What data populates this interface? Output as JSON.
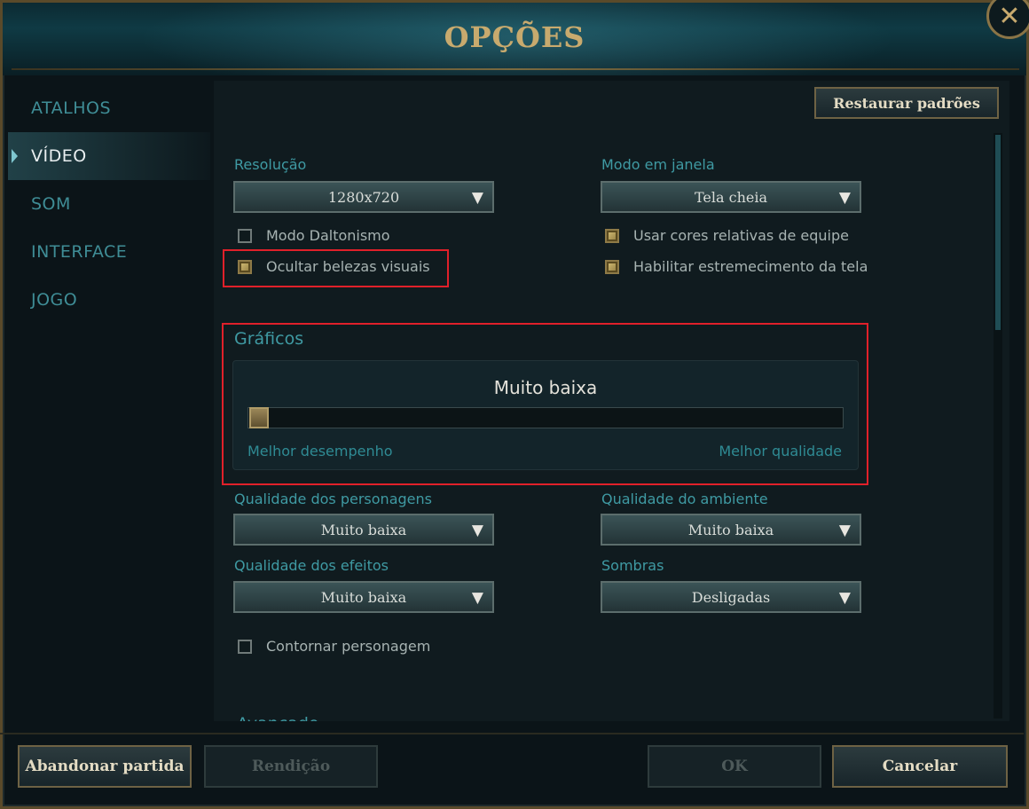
{
  "window": {
    "title": "OPÇÕES",
    "close_glyph": "✕"
  },
  "sidebar": {
    "items": [
      {
        "label": "ATALHOS"
      },
      {
        "label": "VÍDEO"
      },
      {
        "label": "SOM"
      },
      {
        "label": "INTERFACE"
      },
      {
        "label": "JOGO"
      }
    ]
  },
  "toolbar": {
    "restore_label": "Restaurar padrões"
  },
  "video": {
    "resolution_label": "Resolução",
    "resolution_value": "1280x720",
    "window_mode_label": "Modo em janela",
    "window_mode_value": "Tela cheia",
    "colorblind_label": "Modo Daltonismo",
    "colorblind_checked": false,
    "hide_eye_candy_label": "Ocultar belezas visuais",
    "hide_eye_candy_checked": true,
    "relative_team_colors_label": "Usar cores relativas de equipe",
    "relative_team_colors_checked": true,
    "screen_shake_label": "Habilitar estremecimento da tela",
    "screen_shake_checked": true
  },
  "graphics": {
    "title": "Gráficos",
    "level": "Muito baixa",
    "slider_fraction": 0.0,
    "min_label": "Melhor desempenho",
    "max_label": "Melhor qualidade",
    "character_quality_label": "Qualidade dos personagens",
    "character_quality_value": "Muito baixa",
    "environment_quality_label": "Qualidade do ambiente",
    "environment_quality_value": "Muito baixa",
    "effects_quality_label": "Qualidade dos efeitos",
    "effects_quality_value": "Muito baixa",
    "shadows_label": "Sombras",
    "shadows_value": "Desligadas",
    "outline_label": "Contornar personagem",
    "outline_checked": false
  },
  "advanced": {
    "title": "Avançado"
  },
  "footer": {
    "abandon_label": "Abandonar partida",
    "surrender_label": "Rendição",
    "ok_label": "OK",
    "cancel_label": "Cancelar"
  },
  "colors": {
    "accent_gold": "#c8aa6e",
    "label_teal": "#3f9aa3",
    "highlight_red": "#e0202a"
  },
  "icons": {
    "dropdown": "▼",
    "close": "close-icon"
  }
}
